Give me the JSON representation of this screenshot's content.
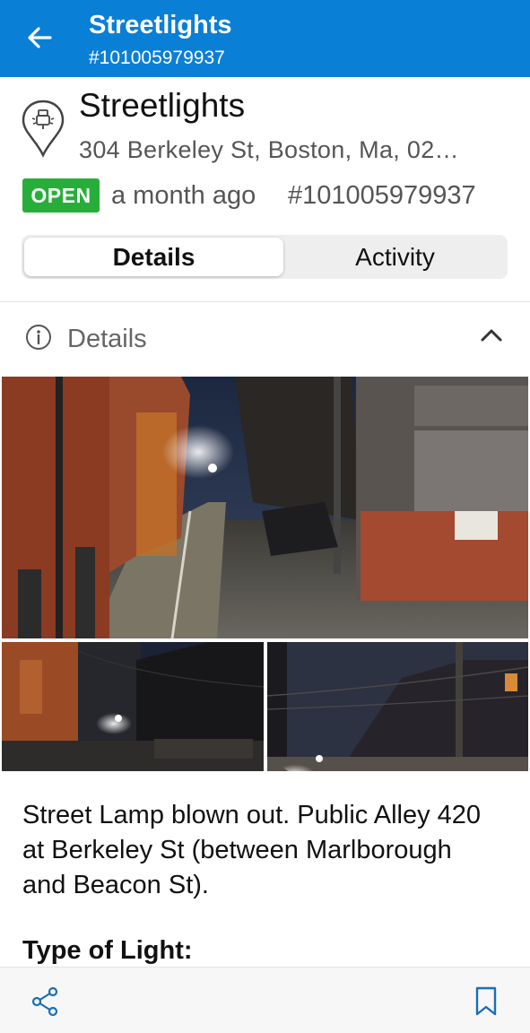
{
  "appbar": {
    "title": "Streetlights",
    "subtitle": "#101005979937"
  },
  "header": {
    "title": "Streetlights",
    "address": "304 Berkeley St, Boston, Ma, 02…",
    "status": "OPEN",
    "time": "a month ago",
    "number": "#101005979937"
  },
  "tabs": [
    {
      "label": "Details",
      "active": true
    },
    {
      "label": "Activity",
      "active": false
    }
  ],
  "section": {
    "label": "Details",
    "expanded": true
  },
  "description": "Street Lamp blown out. Public Alley 420 at Berkeley St (between Marlborough and Beacon St).",
  "type_label": "Type of Light:",
  "icons": [
    "back-arrow-icon",
    "location-pin-icon",
    "info-icon",
    "chevron-up-icon",
    "share-icon",
    "bookmark-icon"
  ],
  "colors": {
    "appbar": "#0a7fd6",
    "status_open": "#27ae3a",
    "accent_icon": "#1a6fb5"
  }
}
